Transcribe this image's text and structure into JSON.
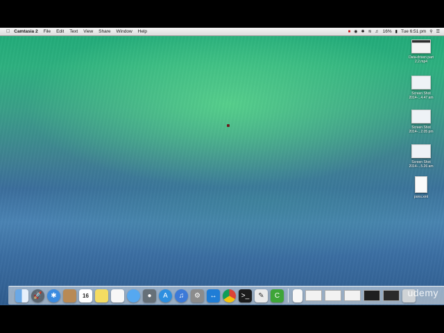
{
  "menubar": {
    "app_name": "Camtasia 2",
    "menus": [
      "File",
      "Edit",
      "Text",
      "View",
      "Share",
      "Window",
      "Help"
    ],
    "status": {
      "battery": "16%",
      "clock": "Tue 6:51 pm"
    }
  },
  "desktop": {
    "icons": [
      {
        "line1": "Data-driven part",
        "line2": "2.2.mp4",
        "kind": "video"
      },
      {
        "line1": "Screen Shot",
        "line2": "2014-...4.47 am",
        "kind": "image"
      },
      {
        "line1": "Screen Shot",
        "line2": "2014-...2.05 pm",
        "kind": "image"
      },
      {
        "line1": "Screen Shot",
        "line2": "2014-...5.26 am",
        "kind": "image"
      },
      {
        "line1": "pons.xml",
        "line2": "",
        "kind": "file"
      }
    ]
  },
  "dock": {
    "calendar_day": "16",
    "apps": [
      "finder-icon",
      "launchpad-icon",
      "safari-icon",
      "contacts-icon",
      "calendar-icon",
      "notes-icon",
      "reminders-icon",
      "messages-icon",
      "facetime-icon",
      "app-store-icon",
      "itunes-icon",
      "system-preferences-icon",
      "teamviewer-icon",
      "chrome-icon",
      "terminal-icon",
      "textedit-icon",
      "camtasia-icon"
    ]
  },
  "watermark": "udemy",
  "colors": {
    "menubar": "#e9e9e9",
    "wallpaper_top": "#1faa78",
    "wallpaper_bottom": "#2f5c8e"
  }
}
